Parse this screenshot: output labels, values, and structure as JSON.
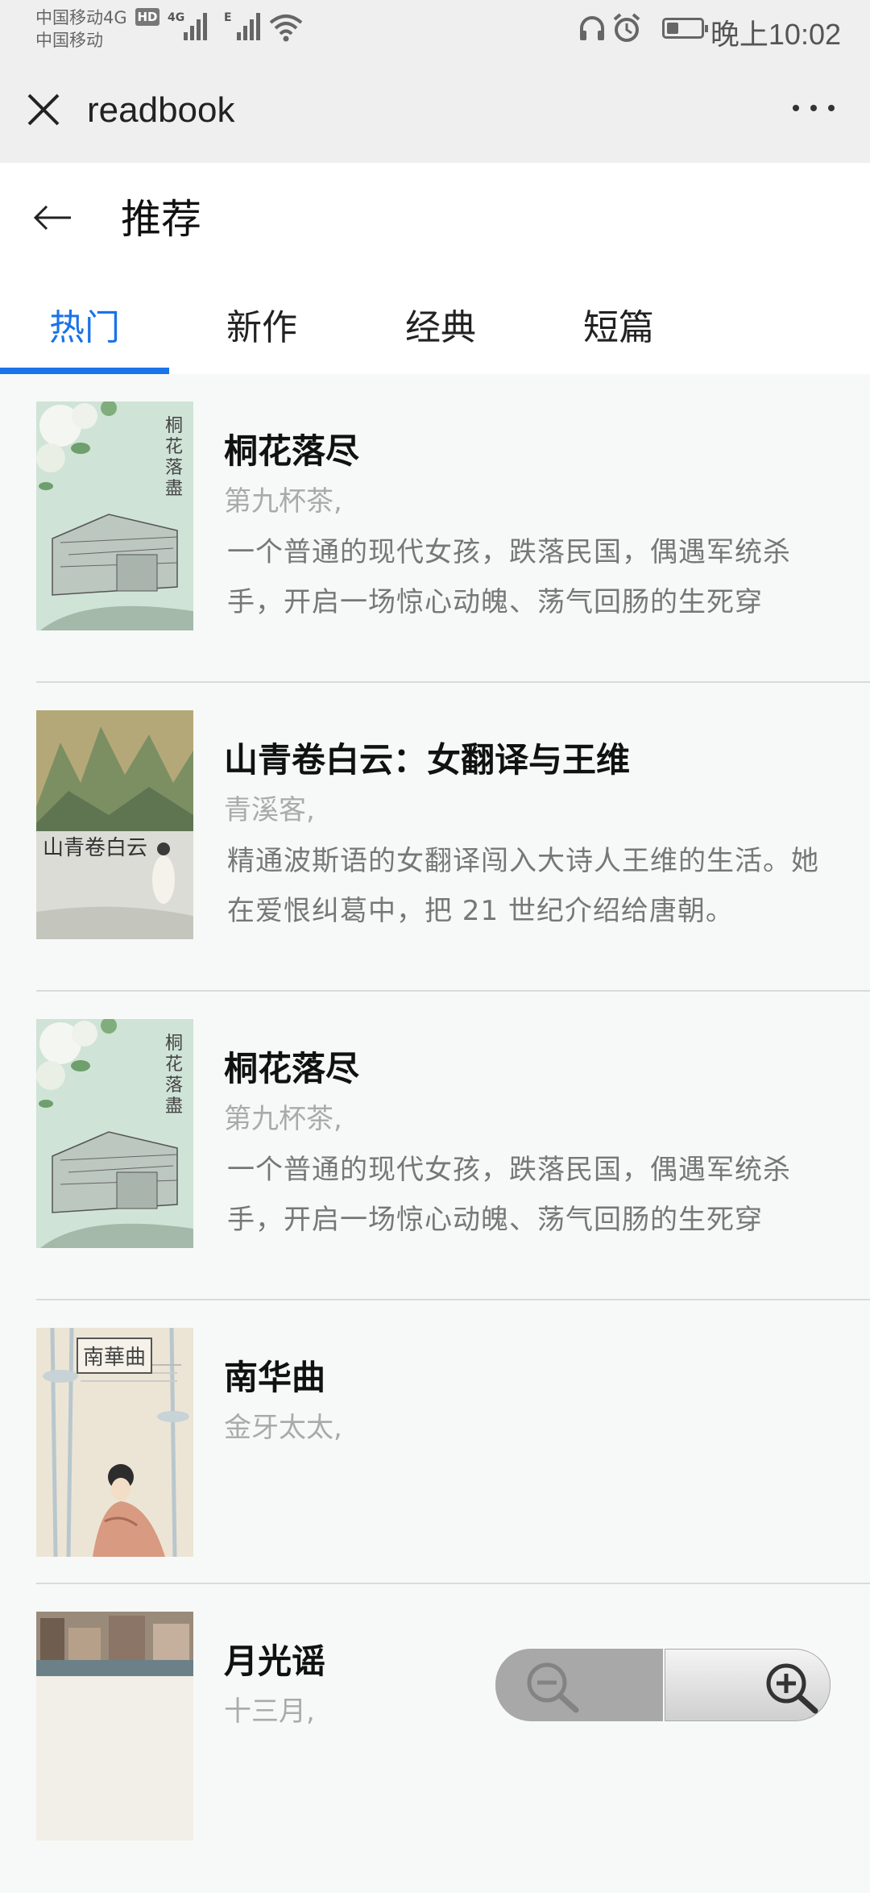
{
  "status_bar": {
    "carrier_line1": "中国移动4G",
    "carrier_line2": "中国移动",
    "hd_badge": "HD",
    "network_4g": "4G",
    "network_e": "E",
    "battery_level": 0.35,
    "time": "晚上10:02",
    "icons": [
      "headphones-icon",
      "alarm-icon",
      "battery-icon",
      "wifi-icon",
      "signal-icon"
    ]
  },
  "titlebar": {
    "title": "readbook"
  },
  "header": {
    "title": "推荐"
  },
  "tabs": [
    {
      "label": "热门",
      "active": true
    },
    {
      "label": "新作",
      "active": false
    },
    {
      "label": "经典",
      "active": false
    },
    {
      "label": "短篇",
      "active": false
    }
  ],
  "books": [
    {
      "title": "桐花落尽",
      "author": "第九杯茶,",
      "description": "一个普通的现代女孩，跌落民国，偶遇军统杀手，开启一场惊心动魄、荡气回肠的生死穿",
      "cover_text": "桐花落盡"
    },
    {
      "title": "山青卷白云：女翻译与王维",
      "author": "青溪客,",
      "description": "精通波斯语的女翻译闯入大诗人王维的生活。她在爱恨纠葛中，把 21 世纪介绍给唐朝。",
      "cover_text": "山青卷白云"
    },
    {
      "title": "桐花落尽",
      "author": "第九杯茶,",
      "description": "一个普通的现代女孩，跌落民国，偶遇军统杀手，开启一场惊心动魄、荡气回肠的生死穿",
      "cover_text": "桐花落盡"
    },
    {
      "title": "南华曲",
      "author": "金牙太太,",
      "description": "",
      "cover_text": "南華曲"
    },
    {
      "title": "月光谣",
      "author": "十三月,",
      "description": "",
      "cover_text": ""
    }
  ],
  "colors": {
    "accent": "#1a73e8",
    "background": "#f6f9f8",
    "chrome": "#efefef"
  }
}
